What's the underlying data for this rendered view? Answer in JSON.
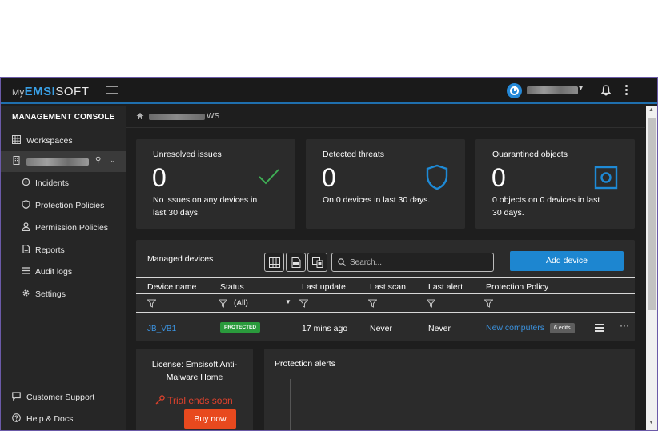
{
  "header": {
    "logo_my": "My",
    "logo_brand": "EMSI",
    "logo_brand2": "SOFT",
    "user_name": "",
    "icons": [
      "hamburger-icon",
      "power-icon",
      "chevron-down-icon",
      "bell-icon",
      "kebab-icon"
    ]
  },
  "sidebar": {
    "title": "MANAGEMENT CONSOLE",
    "workspaces_label": "Workspaces",
    "items": [
      {
        "label": "Incidents",
        "icon": "crosshair-icon"
      },
      {
        "label": "Protection Policies",
        "icon": "shield-icon"
      },
      {
        "label": "Permission Policies",
        "icon": "user-icon"
      },
      {
        "label": "Reports",
        "icon": "document-icon"
      },
      {
        "label": "Audit logs",
        "icon": "list-icon"
      },
      {
        "label": "Settings",
        "icon": "gear-icon"
      }
    ],
    "support_label": "Customer Support",
    "help_label": "Help & Docs"
  },
  "breadcrumb": {
    "suffix": "WS"
  },
  "cards": [
    {
      "title": "Unresolved issues",
      "count": "0",
      "desc": "No issues on any devices in last 30 days.",
      "icon": "check-icon"
    },
    {
      "title": "Detected threats",
      "count": "0",
      "desc": "On 0 devices in last 30 days.",
      "icon": "shield-icon"
    },
    {
      "title": "Quarantined objects",
      "count": "0",
      "desc": "0 objects on 0 devices in last 30 days.",
      "icon": "quarantine-icon"
    }
  ],
  "devices": {
    "title": "Managed devices",
    "search_placeholder": "Search...",
    "add_button": "Add device",
    "columns": [
      "Device name",
      "Status",
      "Last update",
      "Last scan",
      "Last alert",
      "Protection Policy"
    ],
    "status_filter": "(All)",
    "rows": [
      {
        "name": "JB_VB1",
        "status": "PROTECTED",
        "last_update": "17 mins ago",
        "last_scan": "Never",
        "last_alert": "Never",
        "policy": "New computers",
        "edits": "6 edits"
      }
    ]
  },
  "license": {
    "title": "License: Emsisoft Anti-Malware Home",
    "trial": "Trial ends soon",
    "buy_button": "Buy now"
  },
  "alerts": {
    "title": "Protection alerts"
  },
  "colors": {
    "accent": "#1d86d0",
    "danger": "#e8491e",
    "success": "#2a9a3c",
    "link": "#3b93e0"
  }
}
